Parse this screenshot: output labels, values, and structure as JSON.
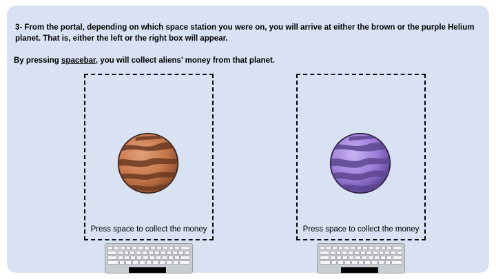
{
  "instructions": {
    "line1": "3- From the portal, depending on which space station you were on, you will arrive at either the brown or the purple Helium planet. That is, either the left or the right box will appear.",
    "line2_prefix": "By pressing ",
    "line2_key": "spacebar",
    "line2_suffix": ", you will collect aliens’ money from that planet."
  },
  "boxes": [
    {
      "planet": "brown-planet",
      "planet_color": "#c7774a",
      "caption": "Press space to collect the money"
    },
    {
      "planet": "purple-planet",
      "planet_color": "#9b7bd8",
      "caption": "Press space to collect the money"
    }
  ],
  "icons": {
    "keyboard": "keyboard-icon",
    "spacebar": "spacebar-highlight"
  },
  "colors": {
    "background": "#d9e2f3",
    "brown": "#c7774a",
    "purple": "#9b7bd8"
  }
}
